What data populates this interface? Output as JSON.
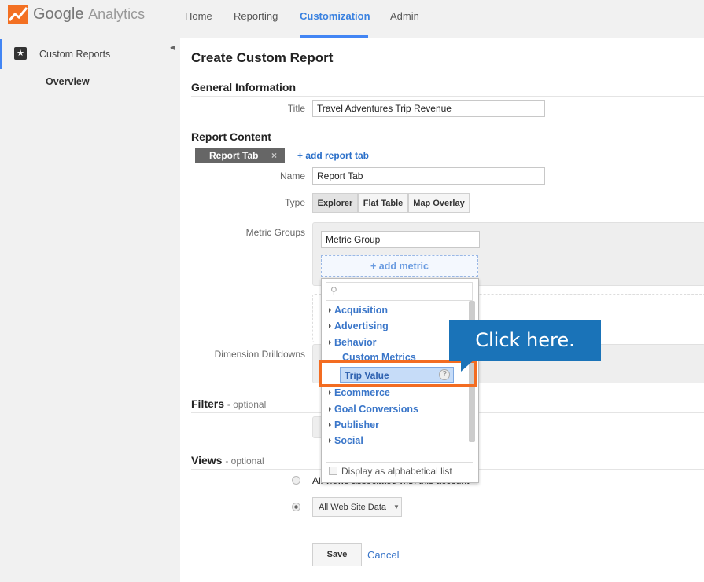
{
  "header": {
    "brand_google": "Google",
    "brand_product": "Analytics",
    "nav": [
      "Home",
      "Reporting",
      "Customization",
      "Admin"
    ],
    "active_nav": "Customization"
  },
  "sidebar": {
    "section": "Custom Reports",
    "items": [
      "Overview"
    ]
  },
  "page": {
    "title": "Create Custom Report",
    "general": {
      "heading": "General Information",
      "title_label": "Title",
      "title_value": "Travel Adventures Trip Revenue"
    },
    "content": {
      "heading": "Report Content",
      "tab_label": "Report Tab",
      "tab_close": "×",
      "add_tab": "+ add report tab",
      "name_label": "Name",
      "name_value": "Report Tab",
      "type_label": "Type",
      "types": [
        "Explorer",
        "Flat Table",
        "Map Overlay"
      ],
      "selected_type": "Explorer",
      "metric_groups_label": "Metric Groups",
      "metric_group_value": "Metric Group",
      "add_metric": "+ add metric",
      "dimension_label": "Dimension Drilldowns"
    },
    "filters": {
      "heading": "Filters",
      "optional": "- optional"
    },
    "views": {
      "heading": "Views",
      "optional": "- optional",
      "option_all": "All views associated with this account",
      "selected_view": "All Web Site Data"
    },
    "save": "Save",
    "cancel": "Cancel"
  },
  "metric_dropdown": {
    "search_placeholder": "",
    "categories": [
      "Acquisition",
      "Advertising",
      "Behavior",
      "Custom Metrics",
      "Ecommerce",
      "Goal Conversions",
      "Publisher",
      "Social"
    ],
    "expanded": "Custom Metrics",
    "custom_metrics": [
      "Trip Value"
    ],
    "help": "?",
    "alphabetical": "Display as alphabetical list"
  },
  "callout": {
    "text": "Click here.",
    "color": "#1a73b8",
    "highlight_color": "#f36c21"
  }
}
